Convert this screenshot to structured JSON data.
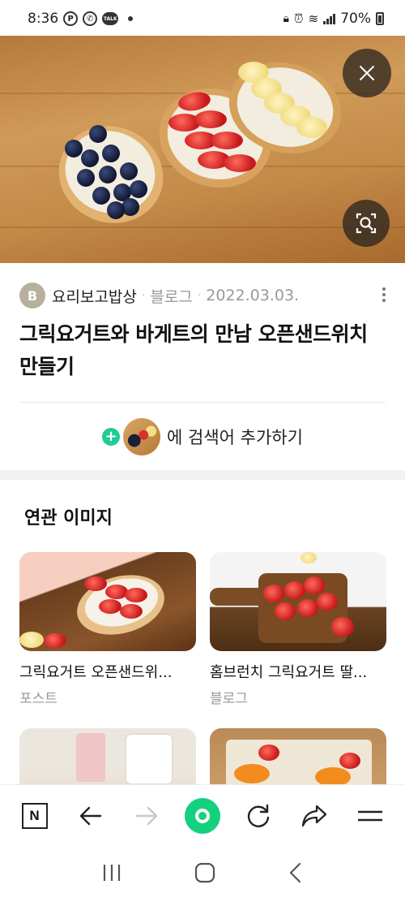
{
  "status": {
    "time": "8:36",
    "battery": "70%"
  },
  "result": {
    "source_initial": "B",
    "source_name": "요리보고밥상",
    "source_type": "블로그",
    "date": "2022.03.03.",
    "title": "그릭요거트와 바게트의 만남 오픈샌드위치 만들기"
  },
  "add_search": {
    "label": "에 검색어 추가하기"
  },
  "related": {
    "heading": "연관 이미지",
    "items": [
      {
        "caption": "그릭요거트 오픈샌드위...",
        "kind": "포스트"
      },
      {
        "caption": "홈브런치 그릭요거트 딸...",
        "kind": "블로그"
      },
      {
        "caption": "",
        "kind": ""
      },
      {
        "caption": "",
        "kind": ""
      }
    ]
  },
  "icons": {
    "close": "close-icon",
    "lens": "image-search-icon",
    "more": "more-vertical-icon",
    "back": "arrow-left-icon",
    "forward": "arrow-right-icon",
    "refresh": "refresh-icon",
    "share": "share-icon",
    "menu": "menu-icon"
  },
  "colors": {
    "accent_green": "#15d07f",
    "plus_green": "#1ecc96"
  }
}
